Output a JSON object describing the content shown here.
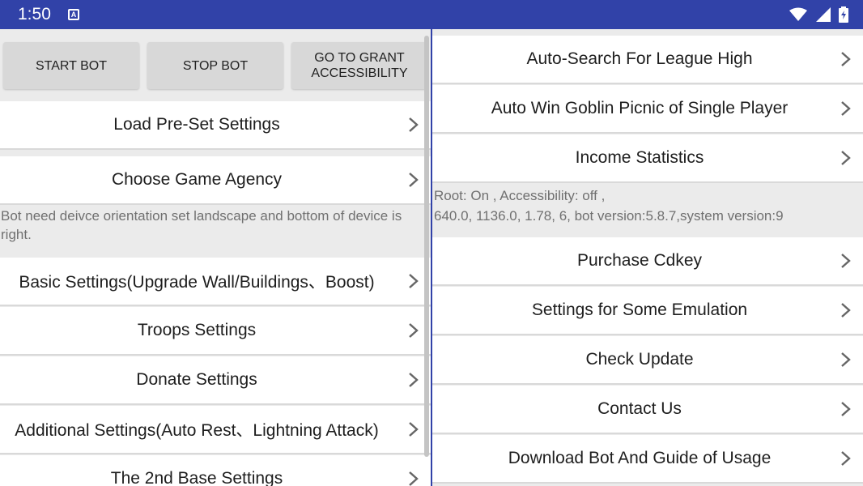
{
  "status": {
    "time": "1:50",
    "notif_letter": "A"
  },
  "left": {
    "buttons": [
      "START BOT",
      "STOP BOT",
      "GO TO GRANT ACCESSIBILITY"
    ],
    "rows": [
      "Load Pre-Set Settings",
      "Choose Game Agency",
      "Basic Settings(Upgrade Wall/Buildings、Boost)",
      "Troops Settings",
      "Donate Settings",
      "Additional Settings(Auto Rest、Lightning Attack)",
      "The 2nd Base Settings"
    ],
    "note": "Bot need deivce orientation set landscape and bottom of device is right."
  },
  "right": {
    "rows": [
      "Auto-Search For League High",
      "Auto Win Goblin Picnic of Single Player",
      "Income Statistics",
      "Purchase Cdkey",
      "Settings for Some Emulation",
      "Check Update",
      "Contact Us",
      "Download Bot And Guide of Usage"
    ],
    "info_line1": "Root: On , Accessibility: off ,",
    "info_line2": "640.0, 1136.0, 1.78, 6, bot version:5.8.7,system version:9"
  },
  "colors": {
    "statusbar": "#3142a8",
    "background": "#ebebeb",
    "row": "#ffffff"
  },
  "icons": [
    "wifi-icon",
    "signal-icon",
    "battery-icon",
    "chevron-right-icon"
  ]
}
